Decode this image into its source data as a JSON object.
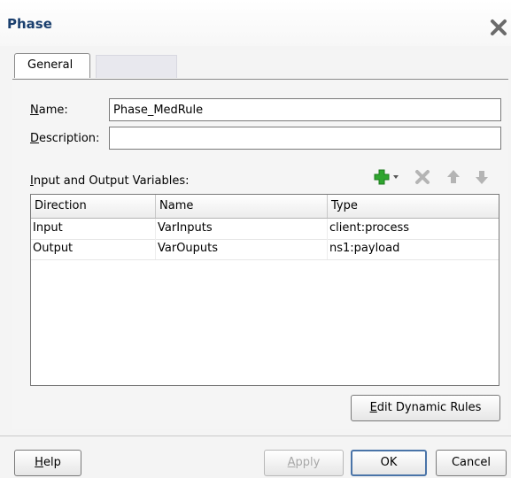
{
  "dialog": {
    "title": "Phase",
    "close_icon": "close-icon"
  },
  "tabs": [
    {
      "label": "General"
    }
  ],
  "form": {
    "name_label_rest": "ame:",
    "name_label_mn": "N",
    "name_value": "Phase_MedRule",
    "description_label_mn": "D",
    "description_label_rest": "escription:",
    "description_value": ""
  },
  "variables": {
    "label_mn": "I",
    "label_rest": "nput and Output Variables:",
    "toolbar": [
      {
        "icon": "add-icon"
      },
      {
        "icon": "delete-icon"
      },
      {
        "icon": "move-up-icon"
      },
      {
        "icon": "move-down-icon"
      }
    ],
    "columns": [
      "Direction",
      "Name",
      "Type"
    ],
    "rows": [
      {
        "direction": "Input",
        "name": "VarInputs",
        "type": "client:process"
      },
      {
        "direction": "Output",
        "name": "VarOuputs",
        "type": "ns1:payload"
      }
    ]
  },
  "buttons": {
    "edit_rules_mn": "E",
    "edit_rules_rest": "dit Dynamic Rules",
    "help_mn": "H",
    "help_rest": "elp",
    "apply_mn": "A",
    "apply_rest": "pply",
    "ok": "OK",
    "cancel": "Cancel"
  },
  "colors": {
    "title": "#1a3f6e",
    "add_icon": "#2fa52f",
    "toolbar_disabled": "#b4b4b4"
  }
}
